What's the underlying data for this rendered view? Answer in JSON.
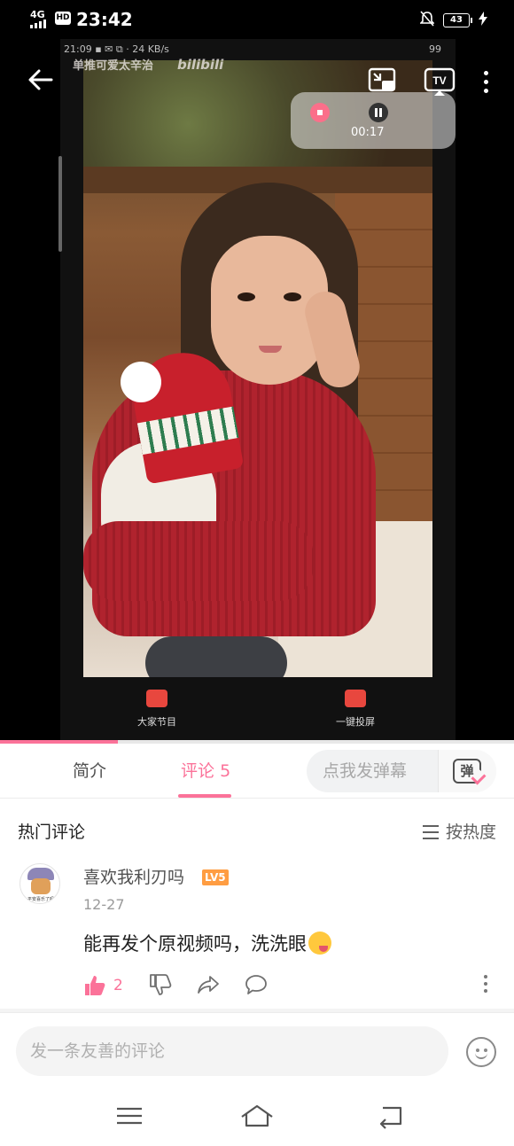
{
  "status_bar": {
    "network": "4G",
    "hd_badge": "HD",
    "time": "23:42",
    "battery": "43"
  },
  "video": {
    "inner_status_left": "21:09 ▪ ✉ ⧉ · 24 KB/s",
    "inner_status_right": "99",
    "inner_title": "单推可爱太辛治",
    "inner_watermark": "bilibili",
    "recorder_time": "00:17",
    "recorder_stop_label": "停止",
    "recorder_pause_label": "暂停",
    "inner_button_left": "大家节目",
    "inner_button_right": "一键投屏",
    "progress_fraction": 0.23
  },
  "tabs": {
    "intro": "简介",
    "comments": "评论",
    "comments_count": "5",
    "danmaku_placeholder": "点我发弹幕",
    "danmaku_icon_label": "弹"
  },
  "comments_section": {
    "title": "热门评论",
    "sort_label": "按热度",
    "items": [
      {
        "username": "喜欢我利刃吗",
        "level": "LV5",
        "date": "12-27",
        "text": "能再发个原视频吗，洗洗眼",
        "likes": "2",
        "avatar_caption": "平安喜乐了吗"
      }
    ]
  },
  "input_bar": {
    "placeholder": "发一条友善的评论"
  },
  "colors": {
    "accent": "#fb7299",
    "level_badge": "#ff9d42"
  }
}
